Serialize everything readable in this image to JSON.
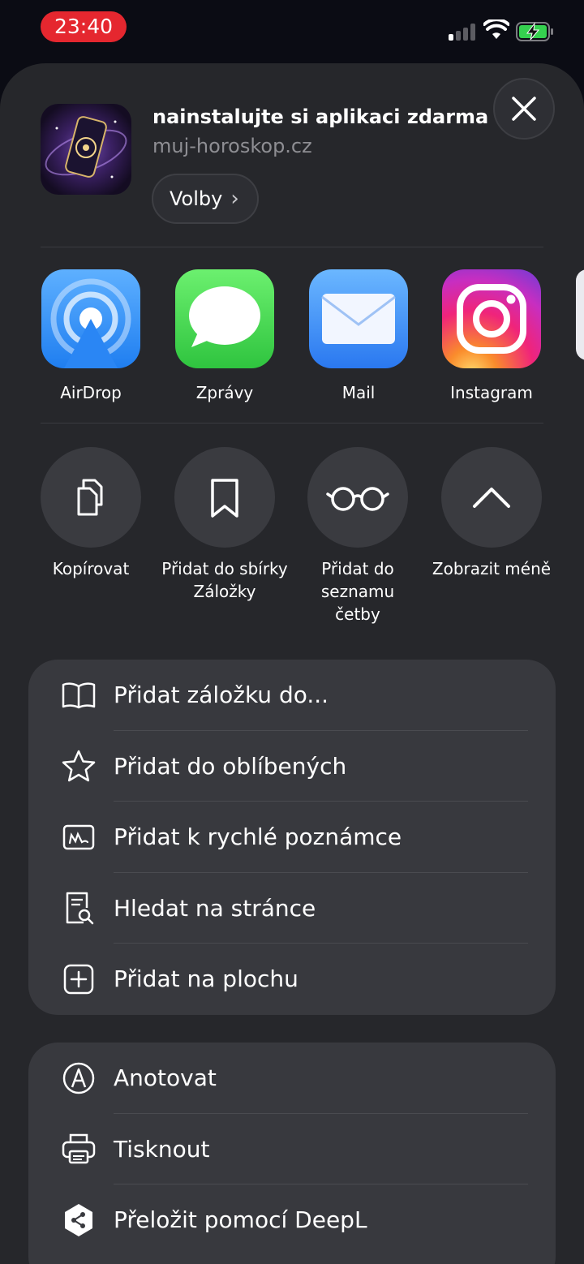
{
  "status_bar": {
    "time": "23:40",
    "time_pill_color": "#e5272f"
  },
  "header": {
    "title": "nainstalujte si aplikaci zdarma",
    "url": "muj-horoskop.cz",
    "options_label": "Volby",
    "options_chevron": "›"
  },
  "apps": [
    {
      "label": "AirDrop",
      "icon": "airdrop-icon"
    },
    {
      "label": "Zprávy",
      "icon": "messages-icon"
    },
    {
      "label": "Mail",
      "icon": "mail-icon"
    },
    {
      "label": "Instagram",
      "icon": "instagram-icon"
    }
  ],
  "actions": [
    {
      "label": "Kopírovat",
      "icon": "copy-icon"
    },
    {
      "label": "Přidat do sbírky Záložky",
      "icon": "bookmark-icon"
    },
    {
      "label": "Přidat do seznamu četby",
      "icon": "glasses-icon"
    },
    {
      "label": "Zobrazit méně",
      "icon": "chevron-up-icon"
    }
  ],
  "menu_group_1": [
    {
      "label": "Přidat záložku do...",
      "icon": "book-icon"
    },
    {
      "label": "Přidat do oblíbených",
      "icon": "star-icon"
    },
    {
      "label": "Přidat k rychlé poznámce",
      "icon": "quick-note-icon"
    },
    {
      "label": "Hledat na stránce",
      "icon": "find-on-page-icon"
    },
    {
      "label": "Přidat na plochu",
      "icon": "add-square-icon"
    }
  ],
  "menu_group_2": [
    {
      "label": "Anotovat",
      "icon": "markup-icon"
    },
    {
      "label": "Tisknout",
      "icon": "printer-icon"
    },
    {
      "label": "Přeložit pomocí DeepL",
      "icon": "deepl-icon"
    }
  ],
  "colors": {
    "sheet": "#26272b",
    "group": "#38393e",
    "circle": "#3a3b40"
  }
}
